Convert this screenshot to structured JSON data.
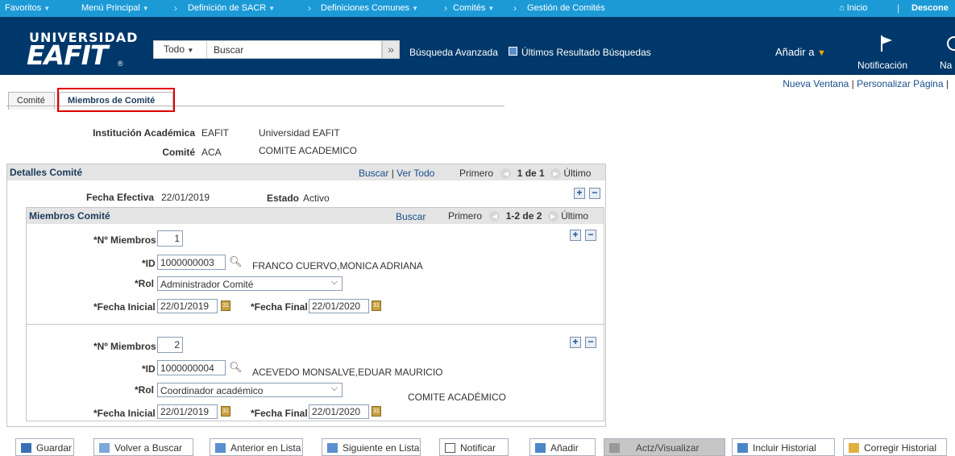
{
  "topnav": {
    "items": [
      "Favoritos",
      "Menú Principal",
      "Definición de SACR",
      "Definiciones Comunes",
      "Comités",
      "Gestión de Comités"
    ],
    "home": "Inicio",
    "logout": "Descone"
  },
  "logo": {
    "line1": "UNIVERSIDAD",
    "line2": "EAFIT",
    "mark": "®"
  },
  "search": {
    "scope": "Todo",
    "placeholder": "Buscar",
    "advanced": "Búsqueda Avanzada",
    "last_results": "Últimos Resultado Búsquedas"
  },
  "header": {
    "add_to": "Añadir a",
    "notifications": "Notificación",
    "nav_partial": "Na"
  },
  "pagelinks": {
    "new_window": "Nueva Ventana",
    "personalize": "Personalizar Página"
  },
  "tabs": [
    "Comité",
    "Miembros de Comité"
  ],
  "form": {
    "institution_label": "Institución Académica",
    "institution_code": "EAFIT",
    "institution_name": "Universidad EAFIT",
    "committee_label": "Comité",
    "committee_code": "ACA",
    "committee_name": "COMITE ACADEMICO"
  },
  "details": {
    "title": "Detalles Comité",
    "search": "Buscar",
    "view_all": "Ver Todo",
    "first": "Primero",
    "count": "1 de 1",
    "last": "Último",
    "eff_date_label": "Fecha Efectiva",
    "eff_date": "22/01/2019",
    "status_label": "Estado",
    "status": "Activo"
  },
  "members": {
    "title": "Miembros Comité",
    "search": "Buscar",
    "first": "Primero",
    "count": "1-2 de 2",
    "last": "Último",
    "num_label": "*Nº Miembros",
    "id_label": "*ID",
    "role_label": "*Rol",
    "start_label": "*Fecha Inicial",
    "end_label": "*Fecha Final",
    "rows": [
      {
        "num": "1",
        "id": "1000000003",
        "name": "FRANCO CUERVO,MONICA ADRIANA",
        "role": "Administrador Comité",
        "start": "22/01/2019",
        "end": "22/01/2020",
        "note": ""
      },
      {
        "num": "2",
        "id": "1000000004",
        "name": "ACEVEDO MONSALVE,EDUAR MAURICIO",
        "role": "Coordinador académico",
        "start": "22/01/2019",
        "end": "22/01/2020",
        "note": "COMITE ACADÉMICO"
      }
    ]
  },
  "toolbar": [
    "Guardar",
    "Volver a Buscar",
    "Anterior en Lista",
    "Siguiente en Lista",
    "Notificar",
    "Añadir",
    "Actz/Visualizar",
    "Incluir Historial",
    "Corregir Historial"
  ],
  "colors": {
    "topnav": "#1c9ad6",
    "header": "#00386b",
    "link": "#1a4e8a",
    "highlight": "#e10000"
  }
}
